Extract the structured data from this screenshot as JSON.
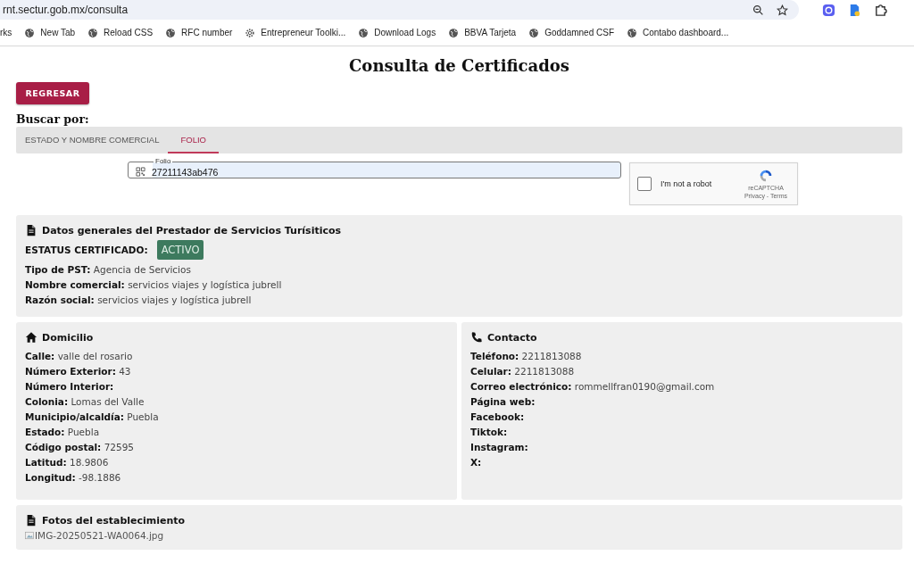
{
  "browser": {
    "url": "rnt.sectur.gob.mx/consulta",
    "bookmarks": [
      {
        "label": "rks",
        "kind": "none"
      },
      {
        "label": "New Tab",
        "kind": "globe"
      },
      {
        "label": "Reload CSS",
        "kind": "globe"
      },
      {
        "label": "RFC number",
        "kind": "globe"
      },
      {
        "label": "Entrepreneur Toolki...",
        "kind": "gear"
      },
      {
        "label": "Download Logs",
        "kind": "globe"
      },
      {
        "label": "BBVA Tarjeta",
        "kind": "globe"
      },
      {
        "label": "Goddamned CSF",
        "kind": "globe"
      },
      {
        "label": "Contabo dashboard...",
        "kind": "globe"
      }
    ]
  },
  "page": {
    "title": "Consulta de Certificados",
    "back_button": "REGRESAR",
    "search_label": "Buscar por:",
    "tabs": [
      {
        "label": "ESTADO Y NOMBRE COMERCIAL",
        "selected": false
      },
      {
        "label": "FOLIO",
        "selected": true
      }
    ],
    "folio_field": {
      "label": "Folio",
      "value": "27211143ab476"
    },
    "captcha": {
      "label": "I'm not a robot",
      "checked": false,
      "brand": "reCAPTCHA",
      "links": "Privacy - Terms"
    },
    "cards": [
      {
        "kind": "document",
        "title": "Datos generales del Prestador de Servicios Turísiticos",
        "status_label": "ESTATUS CERTIFICADO:",
        "status": "ACTIVO",
        "lines": [
          "**Tipo de PST:** Agencia de Servicios",
          "**Nombre comercial:** servicios viajes y logística jubrell",
          "**Razón social:** servicios viajes y logística jubrell"
        ]
      },
      {
        "kind": "home",
        "title": "Domicilio",
        "lines": [
          "**Calle:** valle del rosario",
          "**Número Exterior:** 43",
          "**Número Interior:**",
          "**Colonia:** Lomas del Valle",
          "**Municipio/alcaldía:** Puebla",
          "**Estado:** Puebla",
          "**Código postal:** 72595",
          "**Latitud:** 18.9806",
          "**Longitud:** -98.1886"
        ]
      },
      {
        "kind": "phone",
        "title": "Contacto",
        "lines": [
          "**Teléfono:** 2211813088",
          "**Celular:** 2211813088",
          "**Correo electrónico:** rommellfran0190@gmail.com",
          "**Página web:**",
          "**Facebook:**",
          "**Tiktok:**",
          "**Instagram:**",
          "**X:**"
        ]
      },
      {
        "kind": "document",
        "title": "Fotos del establecimiento",
        "image_alt": "IMG-20250521-WA0064.jpg"
      }
    ]
  }
}
